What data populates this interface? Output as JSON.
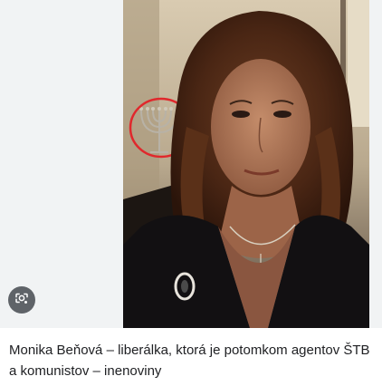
{
  "result": {
    "caption": "Monika Beňová – liberálka, ktorá je potomkom agentov ŠTB a komunistov – inenoviny",
    "image_alt": "Monika Beňová – liberálka, ktorá je potomkom agentov ŠTB a komunistov – inenoviny"
  },
  "icons": {
    "lens": "google-lens-icon"
  },
  "colors": {
    "page_background": "#ffffff",
    "image_background": "#f1f3f4",
    "caption_text": "#202124",
    "lens_button": "#5f6368",
    "annotation_circle": "#e0282c"
  }
}
